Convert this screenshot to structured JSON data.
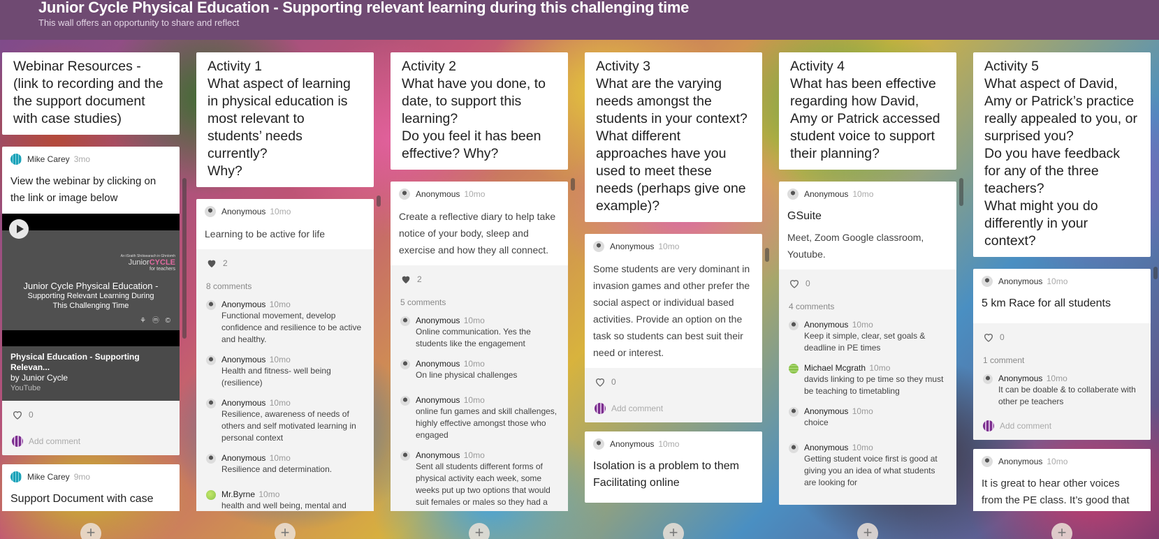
{
  "header": {
    "title": "Junior Cycle Physical Education - Supporting relevant learning during this challenging time",
    "subtitle": "This wall offers an opportunity to share and reflect"
  },
  "add_post_label": "+",
  "columns": [
    {
      "heading": "Webinar Resources - (link to recording and the the support document with case studies)",
      "posts": [
        {
          "author": "Mike Carey",
          "time": "3mo",
          "body": "View the webinar by clicking on the link or image below",
          "video": {
            "slide_logo_top": "An tSraith Shóisearach in Ghníomh",
            "slide_logo_brand": "Junior",
            "slide_logo_brand_accent": "CYCLE",
            "slide_logo_sub": "for teachers",
            "slide_title": "Junior Cycle Physical Education -",
            "slide_subtitle_1": "Supporting Relevant Learning During",
            "slide_subtitle_2": "This Challenging Time",
            "title": "Physical Education - Supporting Relevan...",
            "channel": "by Junior Cycle",
            "source": "YouTube"
          },
          "likes": "0",
          "add_comment": "Add comment"
        },
        {
          "author": "Mike Carey",
          "time": "9mo",
          "title": "Support Document with case"
        }
      ]
    },
    {
      "heading": "Activity 1\nWhat aspect of learning in physical education is most relevant to students’ needs currently?\nWhy?",
      "posts": [
        {
          "author": "Anonymous",
          "time": "10mo",
          "body": "Learning to be active for life",
          "likes": "2",
          "comments_count": "8 comments",
          "comments": [
            {
              "author": "Anonymous",
              "time": "10mo",
              "text": "Functional movement, develop confidence and resilience to be active and healthy."
            },
            {
              "author": "Anonymous",
              "time": "10mo",
              "text": "Health and fitness- well being (resilience)"
            },
            {
              "author": "Anonymous",
              "time": "10mo",
              "text": "Resilience, awareness of needs of others and self motivated learning in personal context"
            },
            {
              "author": "Anonymous",
              "time": "10mo",
              "text": "Resilience and determination."
            },
            {
              "author": "Mr.Byrne",
              "time": "10mo",
              "text": "health and well being, mental and"
            }
          ]
        }
      ]
    },
    {
      "heading": "Activity 2\nWhat have you done, to date, to support this learning?\nDo you feel it has been effective? Why?",
      "posts": [
        {
          "author": "Anonymous",
          "time": "10mo",
          "body": "Create a reflective diary to help take notice of your body, sleep and exercise and how they all connect.",
          "likes": "2",
          "comments_count": "5 comments",
          "comments": [
            {
              "author": "Anonymous",
              "time": "10mo",
              "text": "Online communication. Yes the students like the engagement"
            },
            {
              "author": "Anonymous",
              "time": "10mo",
              "text": "On line physical challenges"
            },
            {
              "author": "Anonymous",
              "time": "10mo",
              "text": "online fun games and skill challenges, highly effective amongst those who engaged"
            },
            {
              "author": "Anonymous",
              "time": "10mo",
              "text": "Sent all students different forms of physical activity each week, some weeks put up two options that would suit females or males so they had a"
            }
          ]
        }
      ]
    },
    {
      "heading": "Activity 3\nWhat are the varying needs amongst the students in your context?\nWhat different approaches have you used to meet these needs (perhaps give one example)?",
      "posts": [
        {
          "author": "Anonymous",
          "time": "10mo",
          "body": "Some students are very dominant in invasion games and other prefer the social aspect or individual based activities. Provide an option on the task so students can best suit their need or interest.",
          "likes": "0",
          "add_comment": "Add comment"
        },
        {
          "author": "Anonymous",
          "time": "10mo",
          "body": "Isolation is a problem to them Facilitating online"
        }
      ]
    },
    {
      "heading": "Activity 4\nWhat has been effective regarding how David, Amy or Patrick accessed student voice to support their planning?",
      "posts": [
        {
          "author": "Anonymous",
          "time": "10mo",
          "title": "GSuite",
          "body": "Meet, Zoom Google classroom, Youtube.",
          "likes": "0",
          "comments_count": "4 comments",
          "comments": [
            {
              "author": "Anonymous",
              "time": "10mo",
              "text": "Keep it simple, clear, set goals & deadline in PE times"
            },
            {
              "author": "Michael Mcgrath",
              "time": "10mo",
              "text": "davids linking to pe time so they must be teaching to timetabling"
            },
            {
              "author": "Anonymous",
              "time": "10mo",
              "text": "choice"
            },
            {
              "author": "Anonymous",
              "time": "10mo",
              "text": "Getting student voice first is good at giving you an idea of what students are looking for"
            }
          ]
        }
      ]
    },
    {
      "heading": "Activity 5\nWhat aspect of David, Amy or Patrick’s practice really appealed to you, or surprised you?\nDo you have feedback for any of the three teachers?\nWhat might you do differently in your context?",
      "posts": [
        {
          "author": "Anonymous",
          "time": "10mo",
          "title": "5 km Race for all students",
          "likes": "0",
          "comments_count": "1 comment",
          "comments": [
            {
              "author": "Anonymous",
              "time": "10mo",
              "text": "It can be doable & to collaberate with other pe teachers"
            }
          ],
          "add_comment": "Add comment"
        },
        {
          "author": "Anonymous",
          "time": "10mo",
          "body": "It is great to hear other voices from the PE class. It’s good that Physical"
        }
      ]
    }
  ]
}
